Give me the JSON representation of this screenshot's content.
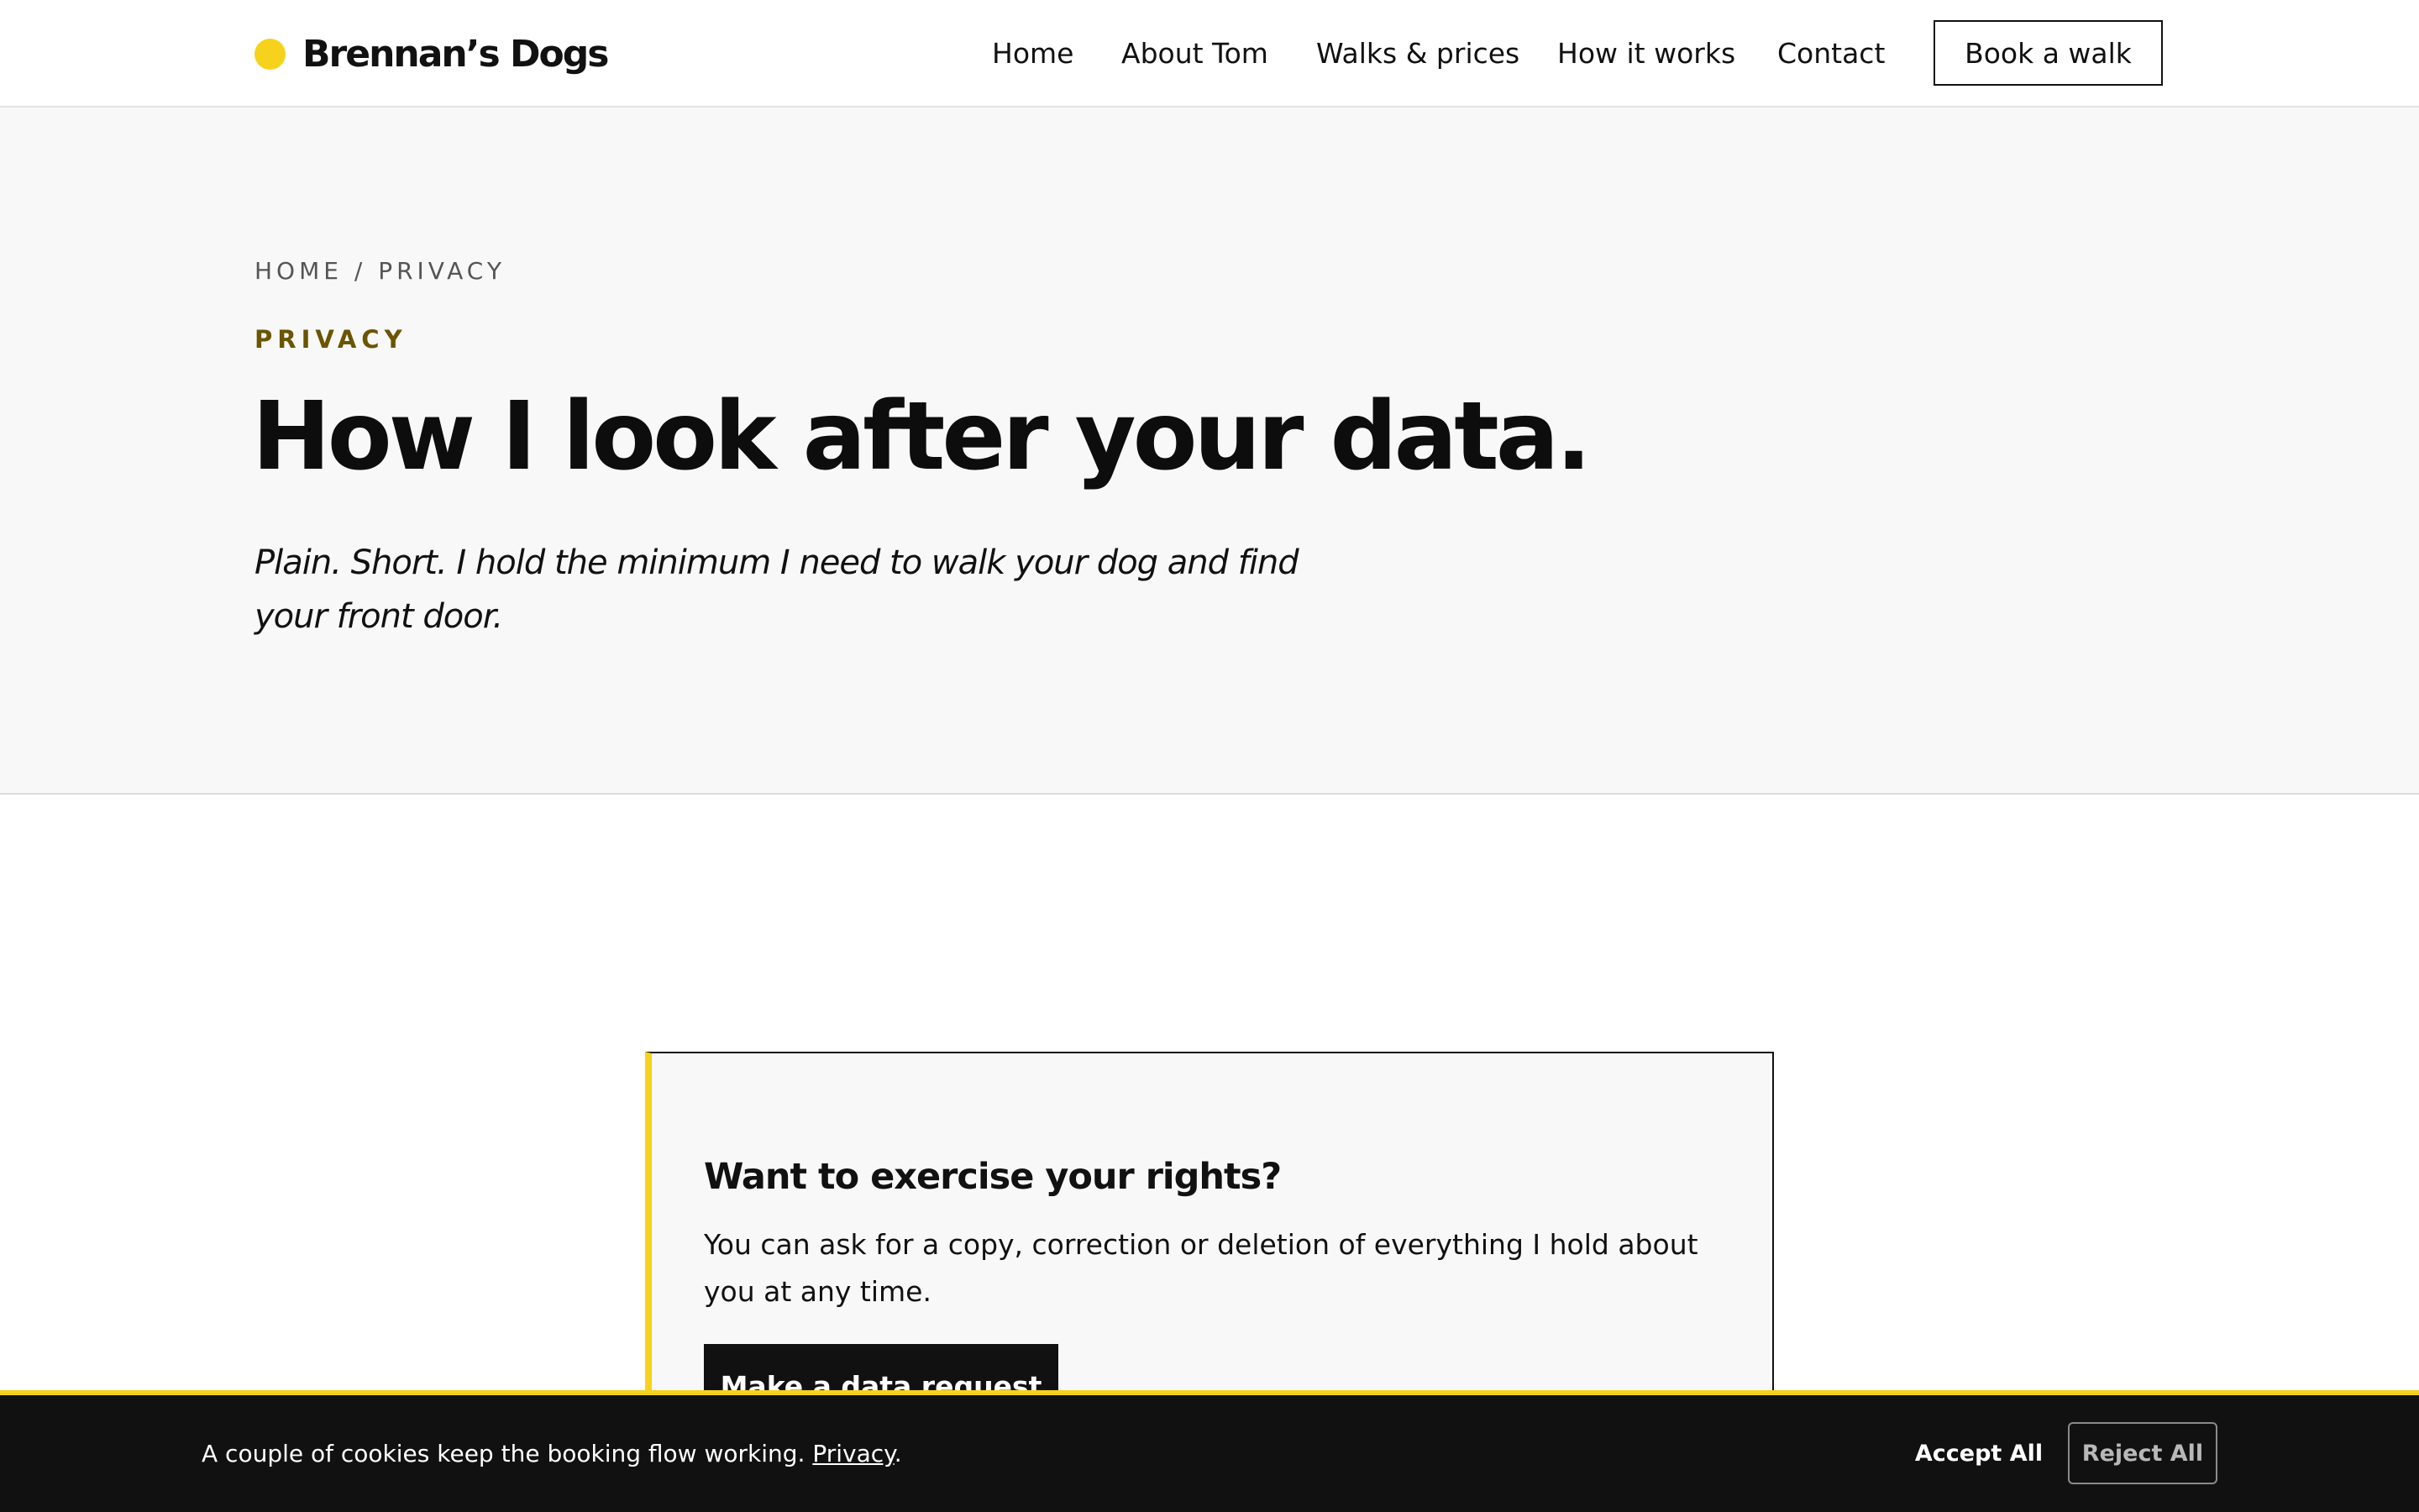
{
  "brand": {
    "name": "Brennan’s Dogs",
    "dot_color": "#f7d21c"
  },
  "nav": {
    "items": [
      "Home",
      "About Tom",
      "Walks & prices",
      "How it works",
      "Contact"
    ],
    "cta": "Book a walk"
  },
  "hero": {
    "breadcrumb": {
      "home": "HOME",
      "separator": " / ",
      "current": "PRIVACY"
    },
    "eyebrow": "PRIVACY",
    "title": "How I look after your data.",
    "lede": "Plain. Short. I hold the minimum I need to walk your dog and find your front door."
  },
  "rights": {
    "title": "Want to exercise your rights?",
    "body": "You can ask for a copy, correction or deletion of everything I hold about you at any time.",
    "button": "Make a data request"
  },
  "cookie_banner": {
    "text": "A couple of cookies keep the booking flow working.",
    "link": "Privacy",
    "suffix": ".",
    "accept": "Accept All",
    "reject": "Reject All"
  },
  "colors": {
    "accent": "#f7d21c",
    "eyebrow": "#6b5500",
    "ink": "#111111",
    "hero_bg": "#f8f8f8"
  }
}
